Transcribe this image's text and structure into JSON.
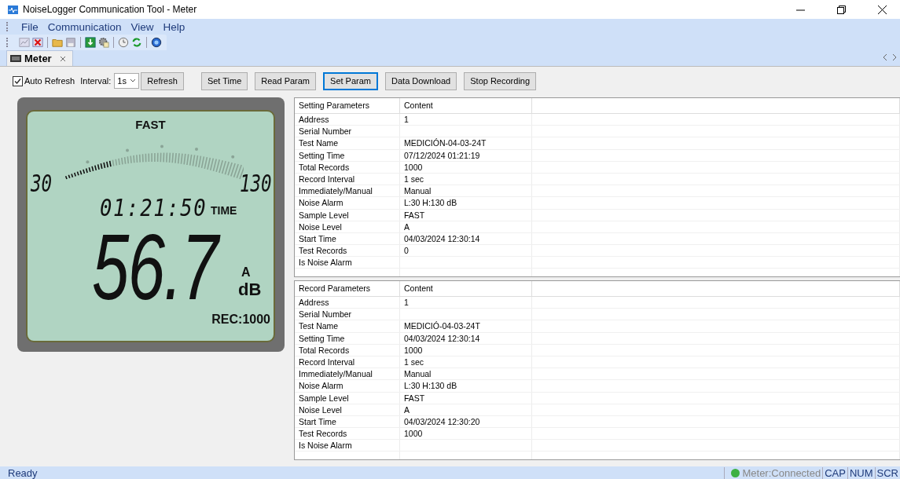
{
  "window": {
    "title": "NoiseLogger Communication Tool - Meter"
  },
  "menu": [
    "File",
    "Communication",
    "View",
    "Help"
  ],
  "toolbar_icons": [
    {
      "kind": "chart"
    },
    {
      "kind": "delete"
    },
    {
      "kind": "sep"
    },
    {
      "kind": "folder"
    },
    {
      "kind": "save"
    },
    {
      "kind": "sep"
    },
    {
      "kind": "download"
    },
    {
      "kind": "gear"
    },
    {
      "kind": "sep"
    },
    {
      "kind": "clock"
    },
    {
      "kind": "refresh"
    },
    {
      "kind": "sep"
    },
    {
      "kind": "help"
    }
  ],
  "tabs": [
    {
      "label": "Meter",
      "selected": true
    }
  ],
  "controls": {
    "auto_refresh": {
      "label": "Auto Refresh",
      "checked": true
    },
    "interval_label": "Interval:",
    "interval": "1s",
    "buttons": [
      {
        "label": "Refresh",
        "selected": false
      },
      {
        "label": "Set Time",
        "selected": false
      },
      {
        "label": "Read Param",
        "selected": false
      },
      {
        "label": "Set Param",
        "selected": true
      },
      {
        "label": "Data Download",
        "selected": false
      },
      {
        "label": "Stop Recording",
        "selected": false
      }
    ]
  },
  "meter": {
    "mode": "FAST",
    "scale_min": "30",
    "scale_max": "130",
    "level": 0.26,
    "time": "01:21:50",
    "time_label": "TIME",
    "reading": "56.7",
    "weighting": "A",
    "unit": "dB",
    "rec": "REC:1000"
  },
  "tables": [
    {
      "columns": [
        "Setting Parameters",
        "Content"
      ],
      "rows": [
        [
          "Address",
          "1"
        ],
        [
          "Serial Number",
          ""
        ],
        [
          "Test Name",
          "MEDICIÓN-04-03-24T"
        ],
        [
          "Setting Time",
          "07/12/2024 01:21:19"
        ],
        [
          "Total Records",
          "1000"
        ],
        [
          "Record Interval",
          "1 sec"
        ],
        [
          "Immediately/Manual",
          "Manual"
        ],
        [
          "Noise Alarm",
          "L:30 H:130 dB"
        ],
        [
          "Sample Level",
          "FAST"
        ],
        [
          "Noise Level",
          "A"
        ],
        [
          "Start Time",
          "04/03/2024 12:30:14"
        ],
        [
          "Test Records",
          "0"
        ],
        [
          "Is Noise Alarm",
          ""
        ]
      ]
    },
    {
      "columns": [
        "Record Parameters",
        "Content"
      ],
      "rows": [
        [
          "Address",
          "1"
        ],
        [
          "Serial Number",
          ""
        ],
        [
          "Test Name",
          "MEDICIÓ-04-03-24T"
        ],
        [
          "Setting Time",
          "04/03/2024 12:30:14"
        ],
        [
          "Total Records",
          "1000"
        ],
        [
          "Record Interval",
          "1 sec"
        ],
        [
          "Immediately/Manual",
          "Manual"
        ],
        [
          "Noise Alarm",
          "L:30 H:130 dB"
        ],
        [
          "Sample Level",
          "FAST"
        ],
        [
          "Noise Level",
          "A"
        ],
        [
          "Start Time",
          "04/03/2024 12:30:20"
        ],
        [
          "Test Records",
          "1000"
        ],
        [
          "Is Noise Alarm",
          ""
        ]
      ]
    }
  ],
  "status_bar": {
    "text": "Ready",
    "connection": "Meter:Connected",
    "indicators": [
      "CAP",
      "NUM",
      "SCR"
    ]
  }
}
